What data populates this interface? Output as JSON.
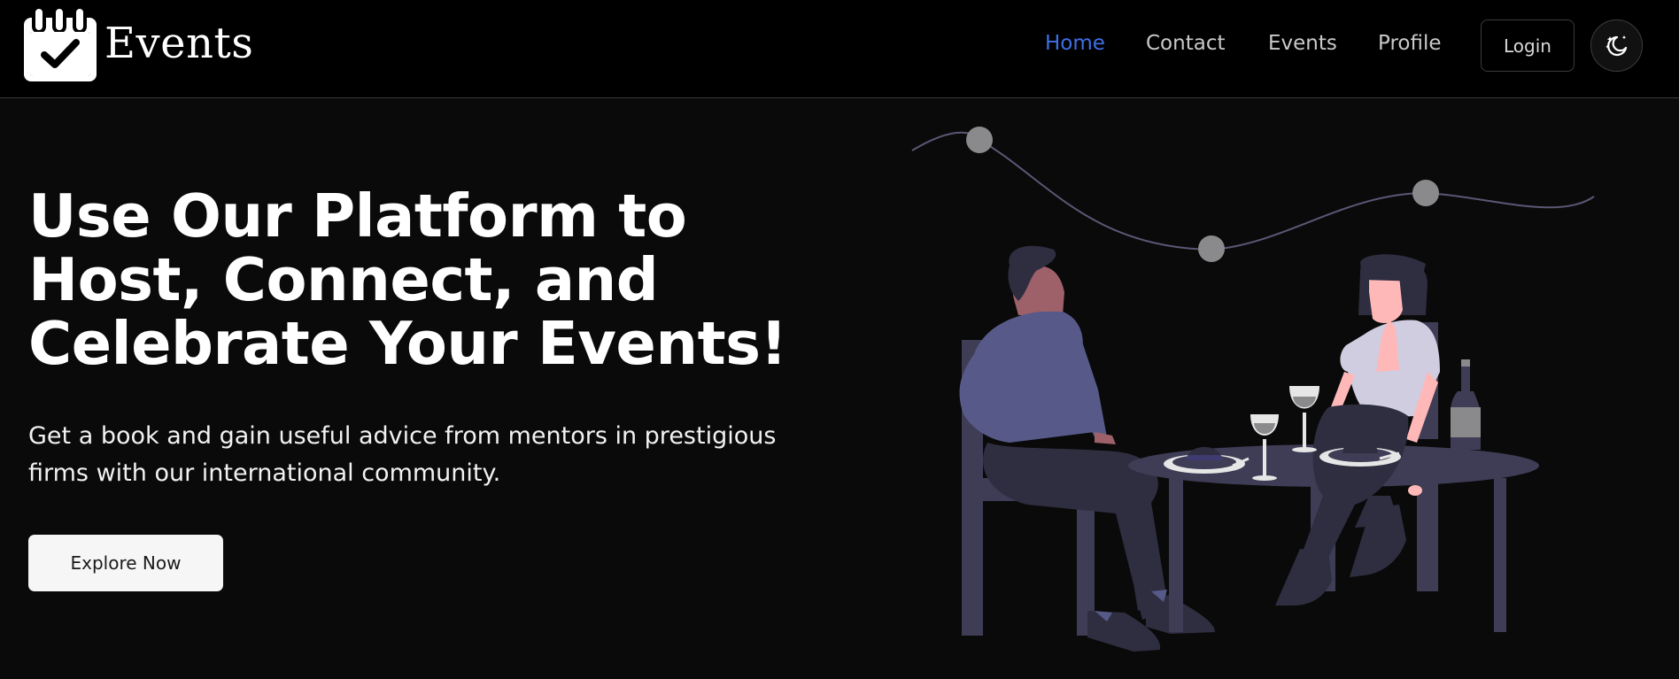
{
  "brand": {
    "name": "Events",
    "logo_icon": "calendar-check-icon"
  },
  "nav": {
    "items": [
      {
        "label": "Home",
        "active": true
      },
      {
        "label": "Contact",
        "active": false
      },
      {
        "label": "Events",
        "active": false
      },
      {
        "label": "Profile",
        "active": false
      }
    ],
    "login_label": "Login",
    "theme_icon": "moon-stars-icon"
  },
  "hero": {
    "title": "Use Our Platform to Host, Connect, and Celebrate Your Events!",
    "subtitle": "Get a book and gain useful advice from mentors in prestigious firms with our international community.",
    "cta_label": "Explore Now"
  },
  "colors": {
    "background": "#0a0a0a",
    "header_bg": "#000000",
    "accent": "#3f6fe6",
    "illustration_primary": "#3f3d56",
    "illustration_shirt": "#575a89"
  }
}
